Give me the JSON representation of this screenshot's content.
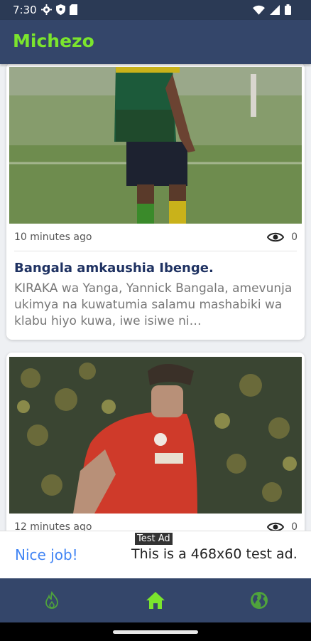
{
  "status_bar": {
    "time": "7:30"
  },
  "app_bar": {
    "title": "Michezo"
  },
  "articles": [
    {
      "time": "10 minutes ago",
      "views": "0",
      "title": "Bangala amkaushia Ibenge.",
      "excerpt": "KIRAKA wa Yanga, Yannick Bangala, amevunja ukimya na kuwatumia salamu mashabiki wa klabu hiyo kuwa, iwe isiwe ni…"
    },
    {
      "time": "12 minutes ago",
      "views": "0",
      "title": "",
      "excerpt": ""
    }
  ],
  "ad": {
    "badge": "Test Ad",
    "nice": "Nice job!",
    "text": "This is a 468x60 test ad."
  },
  "bottom_nav": {
    "items": [
      {
        "icon": "flame-icon",
        "active": false
      },
      {
        "icon": "home-icon",
        "active": true
      },
      {
        "icon": "globe-icon",
        "active": false
      }
    ]
  },
  "colors": {
    "accent": "#7be52d",
    "app_bar": "#34466a",
    "title": "#1f3262",
    "ad_link": "#4285f4"
  }
}
